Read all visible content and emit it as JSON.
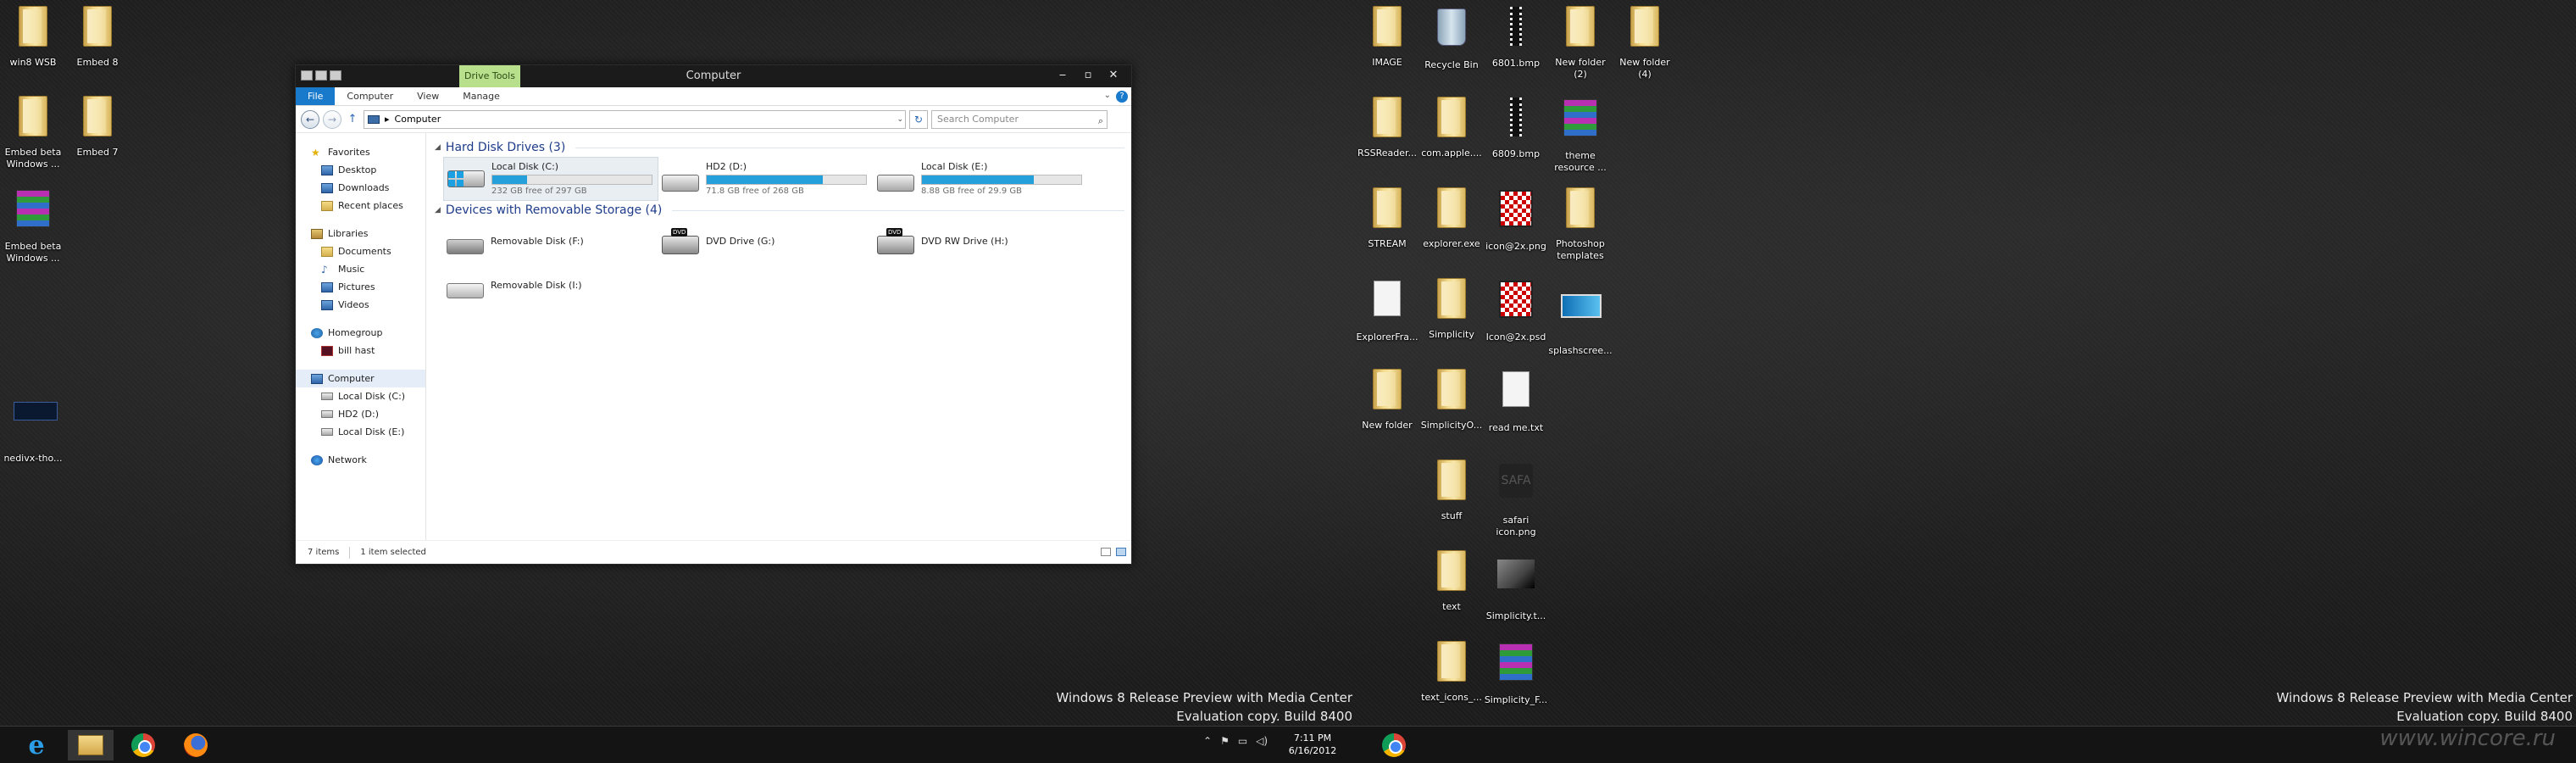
{
  "desktop_left": [
    {
      "label": "win8 WSB",
      "kind": "folder"
    },
    {
      "label": "Embed 8",
      "kind": "folder"
    },
    {
      "label": "Embed beta Windows ...",
      "kind": "folder"
    },
    {
      "label": "Embed 7",
      "kind": "folder"
    },
    {
      "label": "Embed beta Windows ...",
      "kind": "rar"
    },
    {
      "label": "nedivx-tho...",
      "kind": "navthumb"
    }
  ],
  "desktop_right": [
    {
      "label": "IMAGE",
      "kind": "folder"
    },
    {
      "label": "Recycle Bin",
      "kind": "bin"
    },
    {
      "label": "6801.bmp",
      "kind": "filmstrip"
    },
    {
      "label": "New folder (2)",
      "kind": "folder"
    },
    {
      "label": "New folder (4)",
      "kind": "folder"
    },
    {
      "label": "RSSReader...",
      "kind": "folder"
    },
    {
      "label": "com.apple....",
      "kind": "folder"
    },
    {
      "label": "6809.bmp",
      "kind": "filmstrip"
    },
    {
      "label": "theme resource ...",
      "kind": "rar"
    },
    {
      "label": "STREAM",
      "kind": "folder"
    },
    {
      "label": "explorer.exe",
      "kind": "folder"
    },
    {
      "label": "icon@2x.png",
      "kind": "blackpic"
    },
    {
      "label": "Photoshop templates",
      "kind": "folder"
    },
    {
      "label": "ExplorerFra...",
      "kind": "doc"
    },
    {
      "label": "Simplicity",
      "kind": "folder"
    },
    {
      "label": "Icon@2x.psd",
      "kind": "blackpic"
    },
    {
      "label": "splashscree...",
      "kind": "thumb"
    },
    {
      "label": "New folder",
      "kind": "folder"
    },
    {
      "label": "SimplicityO...",
      "kind": "folder"
    },
    {
      "label": "read me.txt",
      "kind": "doc"
    },
    {
      "label": "stuff",
      "kind": "folder"
    },
    {
      "label": "safari icon.png",
      "kind": "safari"
    },
    {
      "label": "text",
      "kind": "folder"
    },
    {
      "label": "Simplicity.t...",
      "kind": "stack"
    },
    {
      "label": "text_icons_...",
      "kind": "folder"
    },
    {
      "label": "Simplicity_F...",
      "kind": "rar"
    }
  ],
  "window": {
    "title": "Computer",
    "context_tab": "Drive Tools",
    "controls": {
      "minimize": "‒",
      "maximize": "▫",
      "close": "✕"
    },
    "ribbon_tabs": [
      "File",
      "Computer",
      "View",
      "Manage"
    ],
    "ribbon_right": {
      "expand": "⌄",
      "help": "?"
    },
    "address": {
      "back": "←",
      "forward": "→",
      "up": "↑",
      "path": "Computer",
      "sep": "▸",
      "dropdown": "⌄",
      "refresh": "↻"
    },
    "search": {
      "placeholder": "Search Computer",
      "icon": "⌕"
    },
    "nav": {
      "favorites": {
        "label": "Favorites",
        "items": [
          "Desktop",
          "Downloads",
          "Recent places"
        ]
      },
      "libraries": {
        "label": "Libraries",
        "items": [
          "Documents",
          "Music",
          "Pictures",
          "Videos"
        ]
      },
      "homegroup": {
        "label": "Homegroup",
        "items": [
          "bill hast"
        ]
      },
      "computer": {
        "label": "Computer",
        "items": [
          "Local Disk (C:)",
          "HD2 (D:)",
          "Local Disk (E:)"
        ]
      },
      "network": {
        "label": "Network"
      }
    },
    "hard_disks": {
      "header": "Hard Disk Drives (3)",
      "drives": [
        {
          "name": "Local Disk (C:)",
          "free": "232 GB free of 297 GB",
          "used_fraction": 0.22,
          "icon": "win8"
        },
        {
          "name": "HD2 (D:)",
          "free": "71.8 GB free of 268 GB",
          "used_fraction": 0.73,
          "icon": "hdd"
        },
        {
          "name": "Local Disk (E:)",
          "free": "8.88 GB free of 29.9 GB",
          "used_fraction": 0.7,
          "icon": "hdd"
        }
      ]
    },
    "removable": {
      "header": "Devices with Removable Storage (4)",
      "devices": [
        {
          "name": "Removable Disk (F:)",
          "icon": "rem-dark"
        },
        {
          "name": "DVD Drive (G:)",
          "icon": "dvd"
        },
        {
          "name": "DVD RW Drive (H:)",
          "icon": "dvd"
        },
        {
          "name": "Removable Disk (I:)",
          "icon": "rem"
        }
      ],
      "dvd_badge": "DVD"
    },
    "status": {
      "items": "7 items",
      "selected": "1 item selected"
    }
  },
  "watermark": {
    "line1": "Windows 8 Release Preview with Media Center",
    "line2": "Evaluation copy. Build 8400"
  },
  "taskbar": {
    "apps": [
      "internet-explorer",
      "file-explorer",
      "chrome",
      "firefox"
    ],
    "ie_glyph": "e",
    "tray": {
      "up": "⌃",
      "flag": "⚑",
      "net": "▭",
      "vol": "◁)"
    },
    "time": "7:11 PM",
    "date": "6/16/2012",
    "site": "www.wincore.ru"
  }
}
